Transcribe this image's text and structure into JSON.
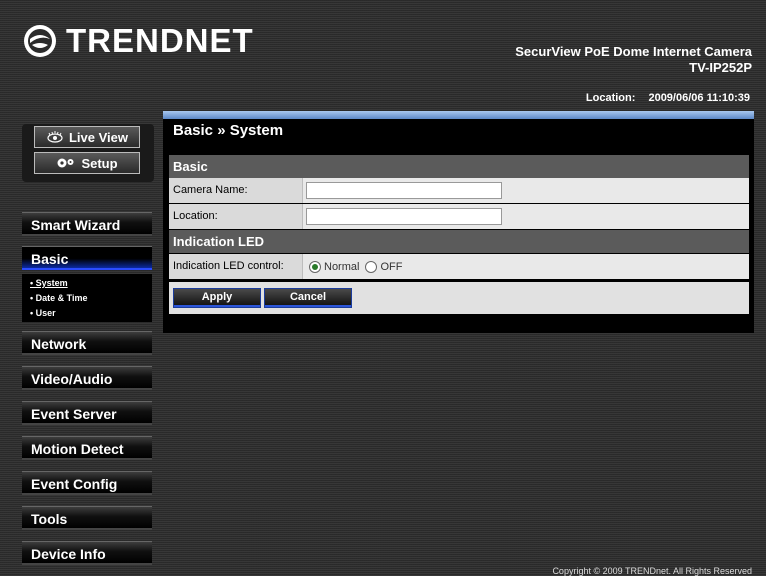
{
  "header": {
    "brand": "TRENDNET",
    "product_line1": "SecurView PoE Dome Internet Camera",
    "product_line2": "TV-IP252P",
    "location_label": "Location:",
    "datetime": "2009/06/06 11:10:39"
  },
  "mode_buttons": {
    "live_view": "Live View",
    "setup": "Setup"
  },
  "nav": {
    "smart_wizard": "Smart Wizard",
    "basic": "Basic",
    "network": "Network",
    "video_audio": "Video/Audio",
    "event_server": "Event Server",
    "motion_detect": "Motion Detect",
    "event_config": "Event Config",
    "tools": "Tools",
    "device_info": "Device Info"
  },
  "submenu": {
    "system": "• System",
    "date_time": "• Date & Time",
    "user": "• User"
  },
  "panel": {
    "title": "Basic » System",
    "section_basic": "Basic",
    "camera_name_label": "Camera Name:",
    "camera_name_value": "",
    "location_label": "Location:",
    "location_value": "",
    "section_led": "Indication LED",
    "led_label": "Indication LED control:",
    "led_option_normal": "Normal",
    "led_option_off": "OFF",
    "led_selected": "Normal",
    "apply": "Apply",
    "cancel": "Cancel"
  },
  "footer": {
    "copyright": "Copyright © 2009 TRENDnet. All Rights Reserved"
  },
  "colors": {
    "accent_blue": "#2b55d8",
    "panel_topline": "#7fa6dc"
  }
}
